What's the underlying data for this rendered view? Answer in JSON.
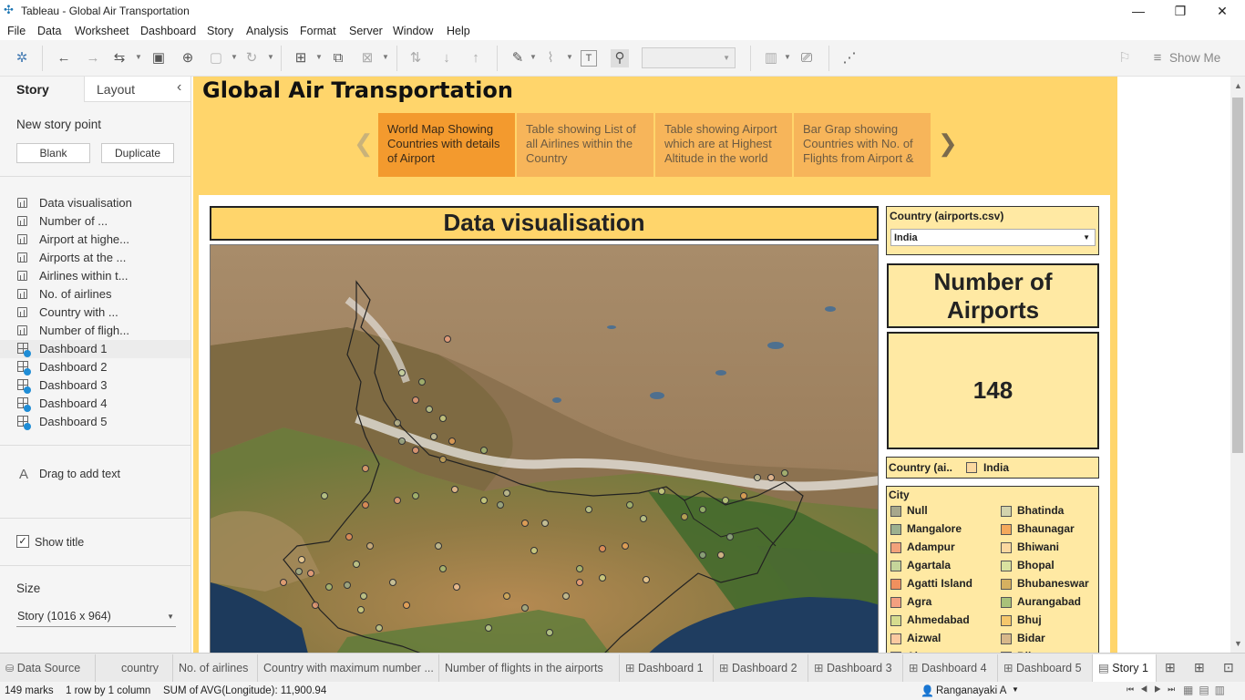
{
  "window": {
    "title": "Tableau - Global Air Transportation",
    "minimize": "—",
    "restore": "❐",
    "close": "✕"
  },
  "menu": [
    "File",
    "Data",
    "Worksheet",
    "Dashboard",
    "Story",
    "Analysis",
    "Format",
    "Server",
    "Window",
    "Help"
  ],
  "toolbar": {
    "show_me": "Show Me"
  },
  "left_pane": {
    "tab_story": "Story",
    "tab_layout": "Layout",
    "collapse": "‹",
    "new_story_point": "New story point",
    "blank_btn": "Blank",
    "duplicate_btn": "Duplicate",
    "sheets": [
      {
        "label": "Data visualisation",
        "type": "sheet"
      },
      {
        "label": "Number of ...",
        "type": "sheet"
      },
      {
        "label": "Airport at highe...",
        "type": "sheet"
      },
      {
        "label": "Airports at the ...",
        "type": "sheet"
      },
      {
        "label": "Airlines within t...",
        "type": "sheet"
      },
      {
        "label": "No. of airlines",
        "type": "sheet"
      },
      {
        "label": "Country with ...",
        "type": "sheet"
      },
      {
        "label": "Number of fligh...",
        "type": "sheet"
      },
      {
        "label": "Dashboard 1",
        "type": "dashboard"
      },
      {
        "label": "Dashboard 2",
        "type": "dashboard"
      },
      {
        "label": "Dashboard 3",
        "type": "dashboard"
      },
      {
        "label": "Dashboard 4",
        "type": "dashboard"
      },
      {
        "label": "Dashboard 5",
        "type": "dashboard"
      }
    ],
    "drag_text": "Drag to add text",
    "show_title": "Show title",
    "size_label": "Size",
    "size_value": "Story (1016 x 964)"
  },
  "story": {
    "title": "Global Air Transportation",
    "points": [
      {
        "text": "World Map Showing Countries with details of Airport",
        "active": true
      },
      {
        "text": "Table showing List of all Airlines within the Country",
        "active": false
      },
      {
        "text": "Table showing Airport which are at Highest Altitude in the world",
        "active": false
      },
      {
        "text": "Bar Grap showing Countries with No. of Flights from Airport &",
        "active": false
      }
    ],
    "prev": "❮",
    "next": "❯"
  },
  "dashboard": {
    "viz_title": "Data visualisation",
    "country_filter_label": "Country (airports.csv)",
    "country_filter_value": "India",
    "kpi_title": "Number of Airports",
    "kpi_value": "148",
    "country_legend_label": "Country (ai..",
    "country_legend_value": "India",
    "city_legend_title": "City",
    "cities_left": [
      {
        "name": "Null",
        "color": "#a7a78c"
      },
      {
        "name": "Mangalore",
        "color": "#9db08f"
      },
      {
        "name": "Adampur",
        "color": "#f2a27a"
      },
      {
        "name": "Agartala",
        "color": "#c5d59a"
      },
      {
        "name": "Agatti Island",
        "color": "#f0905e"
      },
      {
        "name": "Agra",
        "color": "#f3a080"
      },
      {
        "name": "Ahmedabad",
        "color": "#d6dc8e"
      },
      {
        "name": "Aizwal",
        "color": "#fbc9a0"
      },
      {
        "name": "Ajmer",
        "color": "#c8c8a0"
      }
    ],
    "cities_right": [
      {
        "name": "Bhatinda",
        "color": "#d3d3ad"
      },
      {
        "name": "Bhaunagar",
        "color": "#f4a85c"
      },
      {
        "name": "Bhiwani",
        "color": "#fbd8a0"
      },
      {
        "name": "Bhopal",
        "color": "#d9e2a0"
      },
      {
        "name": "Bhubaneswar",
        "color": "#d6b060"
      },
      {
        "name": "Aurangabad",
        "color": "#a9c27a"
      },
      {
        "name": "Bhuj",
        "color": "#f5c76c"
      },
      {
        "name": "Bidar",
        "color": "#d8b88a"
      },
      {
        "name": "Bikaner",
        "color": "#e8c090"
      }
    ]
  },
  "tabs": [
    {
      "label": "Data Source",
      "icon": "database"
    },
    {
      "label": "country",
      "icon": ""
    },
    {
      "label": "No. of airlines",
      "icon": ""
    },
    {
      "label": "Country with maximum number ...",
      "icon": ""
    },
    {
      "label": "Number of flights in the airports",
      "icon": ""
    },
    {
      "label": "Dashboard 1",
      "icon": "dashboard"
    },
    {
      "label": "Dashboard 2",
      "icon": "dashboard"
    },
    {
      "label": "Dashboard 3",
      "icon": "dashboard"
    },
    {
      "label": "Dashboard 4",
      "icon": "dashboard"
    },
    {
      "label": "Dashboard 5",
      "icon": "dashboard"
    },
    {
      "label": "Story 1",
      "icon": "story"
    }
  ],
  "status": {
    "marks": "149 marks",
    "rows": "1 row by 1 column",
    "sum": "SUM of AVG(Longitude): 11,900.94",
    "user": "Ranganayaki A"
  }
}
